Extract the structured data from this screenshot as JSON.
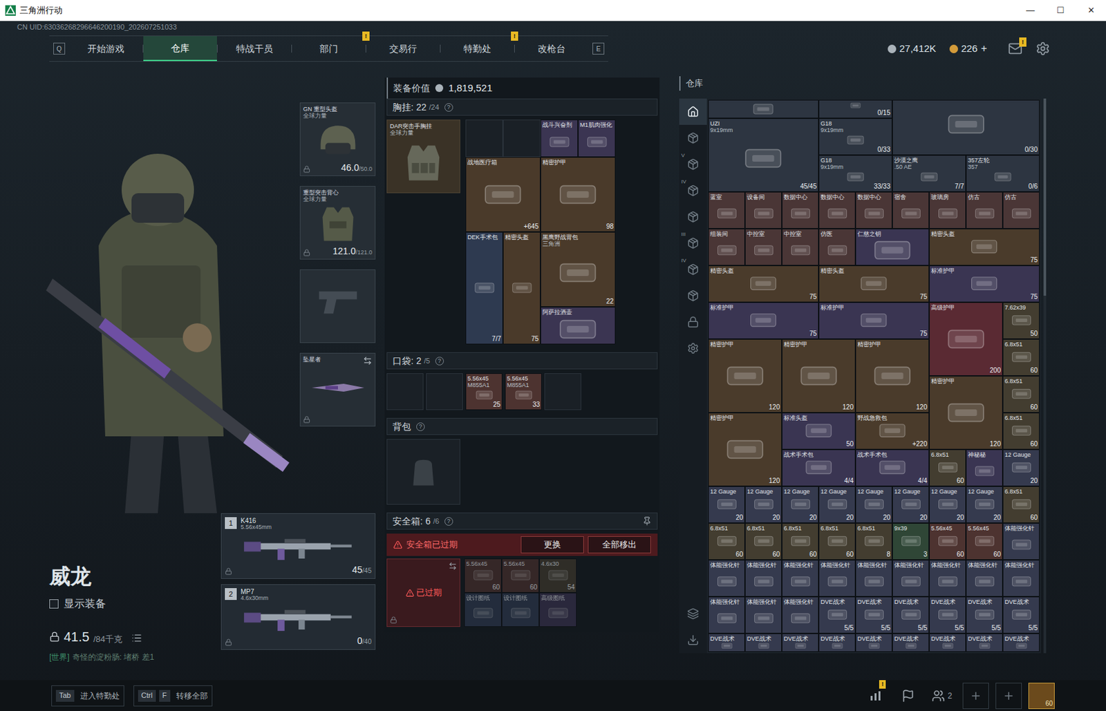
{
  "window": {
    "title": "三角洲行动",
    "controls": [
      "—",
      "☐",
      "✕"
    ]
  },
  "uid": "CN UID:63036268296646200190_202607251033",
  "nav": {
    "prev_key": "Q",
    "next_key": "E",
    "tabs": [
      {
        "label": "开始游戏",
        "selected": false,
        "badge": ""
      },
      {
        "label": "仓库",
        "selected": true,
        "badge": ""
      },
      {
        "label": "特战干员",
        "selected": false,
        "badge": ""
      },
      {
        "label": "部门",
        "selected": false,
        "badge": "!"
      },
      {
        "label": "交易行",
        "selected": false,
        "badge": ""
      },
      {
        "label": "特勤处",
        "selected": false,
        "badge": "!"
      },
      {
        "label": "改枪台",
        "selected": false,
        "badge": ""
      }
    ]
  },
  "wallet": {
    "coins": "27,412K",
    "gold": "226",
    "gold_add": "+",
    "mail_badge": "!"
  },
  "operator": {
    "name": "威龙",
    "show_gear": {
      "label": "显示装备",
      "checked": false
    },
    "weight": "41.5",
    "weight_limit": "/84千克"
  },
  "chat": {
    "channel": "[世界]",
    "message": "奇怪的淀粉肠: 堵桥  差1"
  },
  "equipment": [
    {
      "kind": "helmet",
      "name": "GN 重型头盔",
      "sub": "全球力量",
      "durability": "46.0",
      "max": "/50.0",
      "empty": false
    },
    {
      "kind": "armor",
      "name": "重型突击背心",
      "sub": "全球力量",
      "durability": "121.0",
      "max": "/121.0",
      "empty": false
    },
    {
      "kind": "pistol",
      "name": "",
      "sub": "",
      "durability": "",
      "max": "",
      "empty": true
    },
    {
      "kind": "melee",
      "name": "坠星者",
      "sub": "",
      "durability": "",
      "max": "",
      "empty": false
    }
  ],
  "weapons": [
    {
      "slot": "1",
      "name": "K416",
      "caliber": "5.56x45mm",
      "ammo": "45",
      "capacity": "/45"
    },
    {
      "slot": "2",
      "name": "MP7",
      "caliber": "4.6x30mm",
      "ammo": "0",
      "capacity": "/40"
    }
  ],
  "loadout": {
    "value_label": "装备价值",
    "value": "1,819,521",
    "rig": {
      "label": "胸挂:",
      "count": "22",
      "capacity": "/24",
      "help": "?",
      "name": "DAR突击手胸挂",
      "sub": "全球力量",
      "items": [
        {
          "kind": "empty"
        },
        {
          "kind": "empty"
        },
        {
          "kind": "1x1",
          "name": "战斗兴奋剂",
          "sub": "",
          "value": "",
          "color": "#3b3552"
        },
        {
          "kind": "1x1",
          "name": "M1肌肉强化",
          "sub": "",
          "value": "",
          "color": "#3b3552"
        },
        {
          "kind": "2x2",
          "name": "战地医疗箱",
          "sub": "",
          "value": "+645",
          "color": "#4a3a2a"
        },
        {
          "kind": "2x2",
          "name": "精密护甲",
          "sub": "",
          "value": "98",
          "color": "#4a3a2a"
        },
        {
          "kind": "1x3",
          "name": "DEK手术包",
          "sub": "",
          "value": "7/7",
          "color": "#2e3a50"
        },
        {
          "kind": "1x3",
          "name": "精密头盔",
          "sub": "",
          "value": "75",
          "color": "#4a3a2a"
        },
        {
          "kind": "2x2",
          "name": "黑鹰野战背包",
          "sub": "三角洲",
          "value": "22",
          "color": "#4a3a2a"
        },
        {
          "kind": "2x1",
          "name": "阿萨拉酒壶",
          "sub": "",
          "value": "",
          "color": "#3b3552"
        }
      ]
    },
    "pockets": {
      "label": "口袋:",
      "count": "2",
      "capacity": "/5",
      "help": "?",
      "items": [
        {
          "kind": "empty"
        },
        {
          "kind": "empty"
        },
        {
          "kind": "1x1",
          "name": "5.56x45",
          "sub": "M855A1",
          "value": "25",
          "color": "#4d3330"
        },
        {
          "kind": "1x1",
          "name": "5.56x45",
          "sub": "M855A1",
          "value": "33",
          "color": "#4d3330"
        },
        {
          "kind": "empty"
        }
      ]
    },
    "backpack": {
      "label": "背包",
      "help": "?"
    },
    "safe_case": {
      "label": "安全箱:",
      "count": "6",
      "capacity": "/6",
      "help": "?",
      "warning": "安全箱已过期",
      "buttons": [
        "更换",
        "全部移出"
      ],
      "status": "已过期",
      "expired": true,
      "items": [
        {
          "kind": "1x1",
          "name": "5.56x45",
          "sub": "",
          "value": "60",
          "color": "#4d3330"
        },
        {
          "kind": "1x1",
          "name": "5.56x45",
          "sub": "",
          "value": "60",
          "color": "#4d3330"
        },
        {
          "kind": "1x1",
          "name": "4.6x30",
          "sub": "",
          "value": "54",
          "color": "#433d30"
        },
        {
          "kind": "1x1",
          "name": "设计图纸",
          "sub": "",
          "value": "",
          "color": "#2f3b52"
        },
        {
          "kind": "1x1",
          "name": "设计图纸",
          "sub": "",
          "value": "",
          "color": "#2f3b52"
        },
        {
          "kind": "1x1",
          "name": "高级图纸",
          "sub": "",
          "value": "",
          "color": "#3b3552"
        }
      ]
    }
  },
  "warehouse": {
    "title": "仓库",
    "tabs": [
      {
        "kind": "home",
        "tag": "",
        "selected": true
      },
      {
        "kind": "box",
        "tag": "",
        "selected": false
      },
      {
        "kind": "box",
        "tag": "V",
        "selected": false
      },
      {
        "kind": "box",
        "tag": "IV",
        "selected": false
      },
      {
        "kind": "box",
        "tag": "",
        "selected": false
      },
      {
        "kind": "box",
        "tag": "III",
        "selected": false
      },
      {
        "kind": "box",
        "tag": "IV",
        "selected": false
      },
      {
        "kind": "box",
        "tag": "",
        "selected": false
      },
      {
        "kind": "lock",
        "tag": "",
        "selected": false
      },
      {
        "kind": "gear",
        "tag": "",
        "selected": false
      },
      {
        "kind": "layers",
        "tag": "",
        "selected": false
      },
      {
        "kind": "transfer",
        "tag": "",
        "selected": false
      }
    ],
    "items": [
      {
        "kind": "3x1",
        "name": "",
        "sub": "",
        "value": "",
        "color": "#2d3541"
      },
      {
        "kind": "2x1",
        "name": "",
        "sub": "",
        "value": "0/15",
        "color": "#2d3541"
      },
      {
        "kind": "4x2",
        "name": "",
        "sub": "",
        "value": "0/30",
        "color": "#2d3541"
      },
      {
        "kind": "3x2",
        "name": "UZI",
        "sub": "9x19mm",
        "value": "45/45",
        "color": "#2d3541"
      },
      {
        "kind": "2x1",
        "name": "G18",
        "sub": "9x19mm",
        "value": "0/33",
        "color": "#2d3541"
      },
      {
        "kind": "2x1",
        "name": "G18",
        "sub": "9x19mm",
        "value": "33/33",
        "color": "#2d3541"
      },
      {
        "kind": "2x1",
        "name": "沙漠之鹰",
        "sub": ".50 AE",
        "value": "7/7",
        "color": "#2d3541"
      },
      {
        "kind": "2x1",
        "name": "357左轮",
        "sub": "357",
        "value": "0/6",
        "color": "#2d3541"
      },
      {
        "kind": "1x1",
        "name": "蓝室",
        "sub": "",
        "value": "",
        "color": "#4a3636"
      },
      {
        "kind": "1x1",
        "name": "设备间",
        "sub": "",
        "value": "",
        "color": "#4a3636"
      },
      {
        "kind": "1x1",
        "name": "数据中心",
        "sub": "",
        "value": "",
        "color": "#4a3636"
      },
      {
        "kind": "1x1",
        "name": "数据中心",
        "sub": "",
        "value": "",
        "color": "#4a3636"
      },
      {
        "kind": "1x1",
        "name": "数据中心",
        "sub": "",
        "value": "",
        "color": "#4a3636"
      },
      {
        "kind": "1x1",
        "name": "宿舍",
        "sub": "",
        "value": "",
        "color": "#4a3636"
      },
      {
        "kind": "1x1",
        "name": "玻璃房",
        "sub": "",
        "value": "",
        "color": "#4a3636"
      },
      {
        "kind": "1x1",
        "name": "仿古",
        "sub": "",
        "value": "",
        "color": "#4a3636"
      },
      {
        "kind": "1x1",
        "name": "仿古",
        "sub": "",
        "value": "",
        "color": "#4a3636"
      },
      {
        "kind": "1x1",
        "name": "组装间",
        "sub": "",
        "value": "",
        "color": "#4a3636"
      },
      {
        "kind": "1x1",
        "name": "中控室",
        "sub": "",
        "value": "",
        "color": "#4a3636"
      },
      {
        "kind": "1x1",
        "name": "中控室",
        "sub": "",
        "value": "",
        "color": "#4a3636"
      },
      {
        "kind": "1x1",
        "name": "仿医",
        "sub": "",
        "value": "",
        "color": "#4a3636"
      },
      {
        "kind": "2x1",
        "name": "仁慈之钥",
        "sub": "",
        "value": "",
        "color": "#3a3552"
      },
      {
        "kind": "3x1",
        "name": "精密头盔",
        "sub": "",
        "value": "75",
        "color": "#4a3b2b"
      },
      {
        "kind": "3x1",
        "name": "精密头盔",
        "sub": "",
        "value": "75",
        "color": "#4a3b2b"
      },
      {
        "kind": "3x1",
        "name": "精密头盔",
        "sub": "",
        "value": "75",
        "color": "#4a3b2b"
      },
      {
        "kind": "3x1",
        "name": "标准护甲",
        "sub": "",
        "value": "75",
        "color": "#3a3552"
      },
      {
        "kind": "3x1",
        "name": "标准护甲",
        "sub": "",
        "value": "75",
        "color": "#3a3552"
      },
      {
        "kind": "3x1",
        "name": "标准护甲",
        "sub": "",
        "value": "75",
        "color": "#3a3552"
      },
      {
        "kind": "2x2",
        "name": "高级护甲",
        "sub": "",
        "value": "200",
        "color": "#5a2a33"
      },
      {
        "kind": "1x1",
        "name": "7.62x39",
        "sub": "",
        "value": "50",
        "color": "#433d30"
      },
      {
        "kind": "2x2",
        "name": "精密护甲",
        "sub": "",
        "value": "120",
        "color": "#4a3b2b"
      },
      {
        "kind": "2x2",
        "name": "精密护甲",
        "sub": "",
        "value": "120",
        "color": "#4a3b2b"
      },
      {
        "kind": "2x2",
        "name": "精密护甲",
        "sub": "",
        "value": "120",
        "color": "#4a3b2b"
      },
      {
        "kind": "1x1",
        "name": "6.8x51",
        "sub": "",
        "value": "60",
        "color": "#433d30"
      },
      {
        "kind": "2x2",
        "name": "精密护甲",
        "sub": "",
        "value": "120",
        "color": "#4a3b2b"
      },
      {
        "kind": "1x1",
        "name": "6.8x51",
        "sub": "",
        "value": "60",
        "color": "#433d30"
      },
      {
        "kind": "2x2",
        "name": "精密护甲",
        "sub": "",
        "value": "120",
        "color": "#4a3b2b"
      },
      {
        "kind": "2x1",
        "name": "标准头盔",
        "sub": "",
        "value": "50",
        "color": "#3a3552"
      },
      {
        "kind": "2x1",
        "name": "野战急救包",
        "sub": "",
        "value": "+220",
        "color": "#4a3b2b"
      },
      {
        "kind": "1x1",
        "name": "6.8x51",
        "sub": "",
        "value": "60",
        "color": "#433d30"
      },
      {
        "kind": "2x1",
        "name": "战术手术包",
        "sub": "",
        "value": "4/4",
        "color": "#3a3552"
      },
      {
        "kind": "2x1",
        "name": "战术手术包",
        "sub": "",
        "value": "4/4",
        "color": "#3a3552"
      },
      {
        "kind": "1x1",
        "name": "6.8x51",
        "sub": "",
        "value": "60",
        "color": "#433d30"
      },
      {
        "kind": "1x1",
        "name": "神秘秘",
        "sub": "",
        "value": "",
        "color": "#3a3552"
      },
      {
        "kind": "1x1",
        "name": "12 Gauge",
        "sub": "",
        "value": "20",
        "color": "#353a4e"
      },
      {
        "kind": "1x1",
        "name": "12 Gauge",
        "sub": "",
        "value": "20",
        "color": "#353a4e"
      },
      {
        "kind": "1x1",
        "name": "12 Gauge",
        "sub": "",
        "value": "20",
        "color": "#353a4e"
      },
      {
        "kind": "1x1",
        "name": "12 Gauge",
        "sub": "",
        "value": "20",
        "color": "#353a4e"
      },
      {
        "kind": "1x1",
        "name": "12 Gauge",
        "sub": "",
        "value": "20",
        "color": "#353a4e"
      },
      {
        "kind": "1x1",
        "name": "12 Gauge",
        "sub": "",
        "value": "20",
        "color": "#353a4e"
      },
      {
        "kind": "1x1",
        "name": "12 Gauge",
        "sub": "",
        "value": "20",
        "color": "#353a4e"
      },
      {
        "kind": "1x1",
        "name": "12 Gauge",
        "sub": "",
        "value": "20",
        "color": "#353a4e"
      },
      {
        "kind": "1x1",
        "name": "12 Gauge",
        "sub": "",
        "value": "20",
        "color": "#353a4e"
      },
      {
        "kind": "1x1",
        "name": "6.8x51",
        "sub": "",
        "value": "60",
        "color": "#433d30"
      },
      {
        "kind": "1x1",
        "name": "6.8x51",
        "sub": "",
        "value": "60",
        "color": "#433d30"
      },
      {
        "kind": "1x1",
        "name": "6.8x51",
        "sub": "",
        "value": "60",
        "color": "#433d30"
      },
      {
        "kind": "1x1",
        "name": "6.8x51",
        "sub": "",
        "value": "60",
        "color": "#433d30"
      },
      {
        "kind": "1x1",
        "name": "6.8x51",
        "sub": "",
        "value": "60",
        "color": "#433d30"
      },
      {
        "kind": "1x1",
        "name": "6.8x51",
        "sub": "",
        "value": "8",
        "color": "#433d30"
      },
      {
        "kind": "1x1",
        "name": "9x39",
        "sub": "",
        "value": "3",
        "color": "#2f4636"
      },
      {
        "kind": "1x1",
        "name": "5.56x45",
        "sub": "",
        "value": "60",
        "color": "#4d3330"
      },
      {
        "kind": "1x1",
        "name": "5.56x45",
        "sub": "",
        "value": "60",
        "color": "#4d3330"
      },
      {
        "kind": "1x1",
        "name": "体能强化针",
        "sub": "",
        "value": "",
        "color": "#353a4e"
      },
      {
        "kind": "1x1",
        "name": "体能强化针",
        "sub": "",
        "value": "",
        "color": "#353a4e"
      },
      {
        "kind": "1x1",
        "name": "体能强化针",
        "sub": "",
        "value": "",
        "color": "#353a4e"
      },
      {
        "kind": "1x1",
        "name": "体能强化针",
        "sub": "",
        "value": "",
        "color": "#353a4e"
      },
      {
        "kind": "1x1",
        "name": "体能强化针",
        "sub": "",
        "value": "",
        "color": "#353a4e"
      },
      {
        "kind": "1x1",
        "name": "体能强化针",
        "sub": "",
        "value": "",
        "color": "#353a4e"
      },
      {
        "kind": "1x1",
        "name": "体能强化针",
        "sub": "",
        "value": "",
        "color": "#353a4e"
      },
      {
        "kind": "1x1",
        "name": "体能强化针",
        "sub": "",
        "value": "",
        "color": "#353a4e"
      },
      {
        "kind": "1x1",
        "name": "体能强化针",
        "sub": "",
        "value": "",
        "color": "#353a4e"
      },
      {
        "kind": "1x1",
        "name": "体能强化针",
        "sub": "",
        "value": "",
        "color": "#353a4e"
      },
      {
        "kind": "1x1",
        "name": "体能强化针",
        "sub": "",
        "value": "",
        "color": "#353a4e"
      },
      {
        "kind": "1x1",
        "name": "体能强化针",
        "sub": "",
        "value": "",
        "color": "#353a4e"
      },
      {
        "kind": "1x1",
        "name": "体能强化针",
        "sub": "",
        "value": "",
        "color": "#353a4e"
      },
      {
        "kind": "1x1",
        "name": "DVE战术",
        "sub": "",
        "value": "5/5",
        "color": "#353a4e"
      },
      {
        "kind": "1x1",
        "name": "DVE战术",
        "sub": "",
        "value": "5/5",
        "color": "#353a4e"
      },
      {
        "kind": "1x1",
        "name": "DVE战术",
        "sub": "",
        "value": "5/5",
        "color": "#353a4e"
      },
      {
        "kind": "1x1",
        "name": "DVE战术",
        "sub": "",
        "value": "5/5",
        "color": "#353a4e"
      },
      {
        "kind": "1x1",
        "name": "DVE战术",
        "sub": "",
        "value": "5/5",
        "color": "#353a4e"
      },
      {
        "kind": "1x1",
        "name": "DVE战术",
        "sub": "",
        "value": "5/5",
        "color": "#353a4e"
      },
      {
        "kind": "1x1",
        "name": "DVE战术",
        "sub": "",
        "value": "",
        "color": "#353a4e"
      },
      {
        "kind": "1x1",
        "name": "DVE战术",
        "sub": "",
        "value": "",
        "color": "#353a4e"
      },
      {
        "kind": "1x1",
        "name": "DVE战术",
        "sub": "",
        "value": "",
        "color": "#353a4e"
      },
      {
        "kind": "1x1",
        "name": "DVE战术",
        "sub": "",
        "value": "",
        "color": "#353a4e"
      },
      {
        "kind": "1x1",
        "name": "DVE战术",
        "sub": "",
        "value": "",
        "color": "#353a4e"
      },
      {
        "kind": "1x1",
        "name": "DVE战术",
        "sub": "",
        "value": "",
        "color": "#353a4e"
      },
      {
        "kind": "1x1",
        "name": "DVE战术",
        "sub": "",
        "value": "",
        "color": "#353a4e"
      },
      {
        "kind": "1x1",
        "name": "DVE战术",
        "sub": "",
        "value": "",
        "color": "#353a4e"
      },
      {
        "kind": "1x1",
        "name": "DVE战术",
        "sub": "",
        "value": "",
        "color": "#353a4e"
      }
    ]
  },
  "bottom": {
    "hints": [
      {
        "keys": [
          "Tab"
        ],
        "label": "进入特勤处"
      },
      {
        "keys": [
          "Ctrl",
          "F"
        ],
        "label": "转移全部"
      }
    ],
    "icons": [
      {
        "kind": "chart",
        "badge": "!",
        "text": ""
      },
      {
        "kind": "flag",
        "badge": "",
        "text": ""
      },
      {
        "kind": "friends",
        "badge": "",
        "text": "2"
      },
      {
        "kind": "plus",
        "badge": "",
        "text": ""
      },
      {
        "kind": "plus",
        "badge": "",
        "text": ""
      },
      {
        "kind": "avatar",
        "badge": "",
        "text": "60"
      }
    ]
  }
}
